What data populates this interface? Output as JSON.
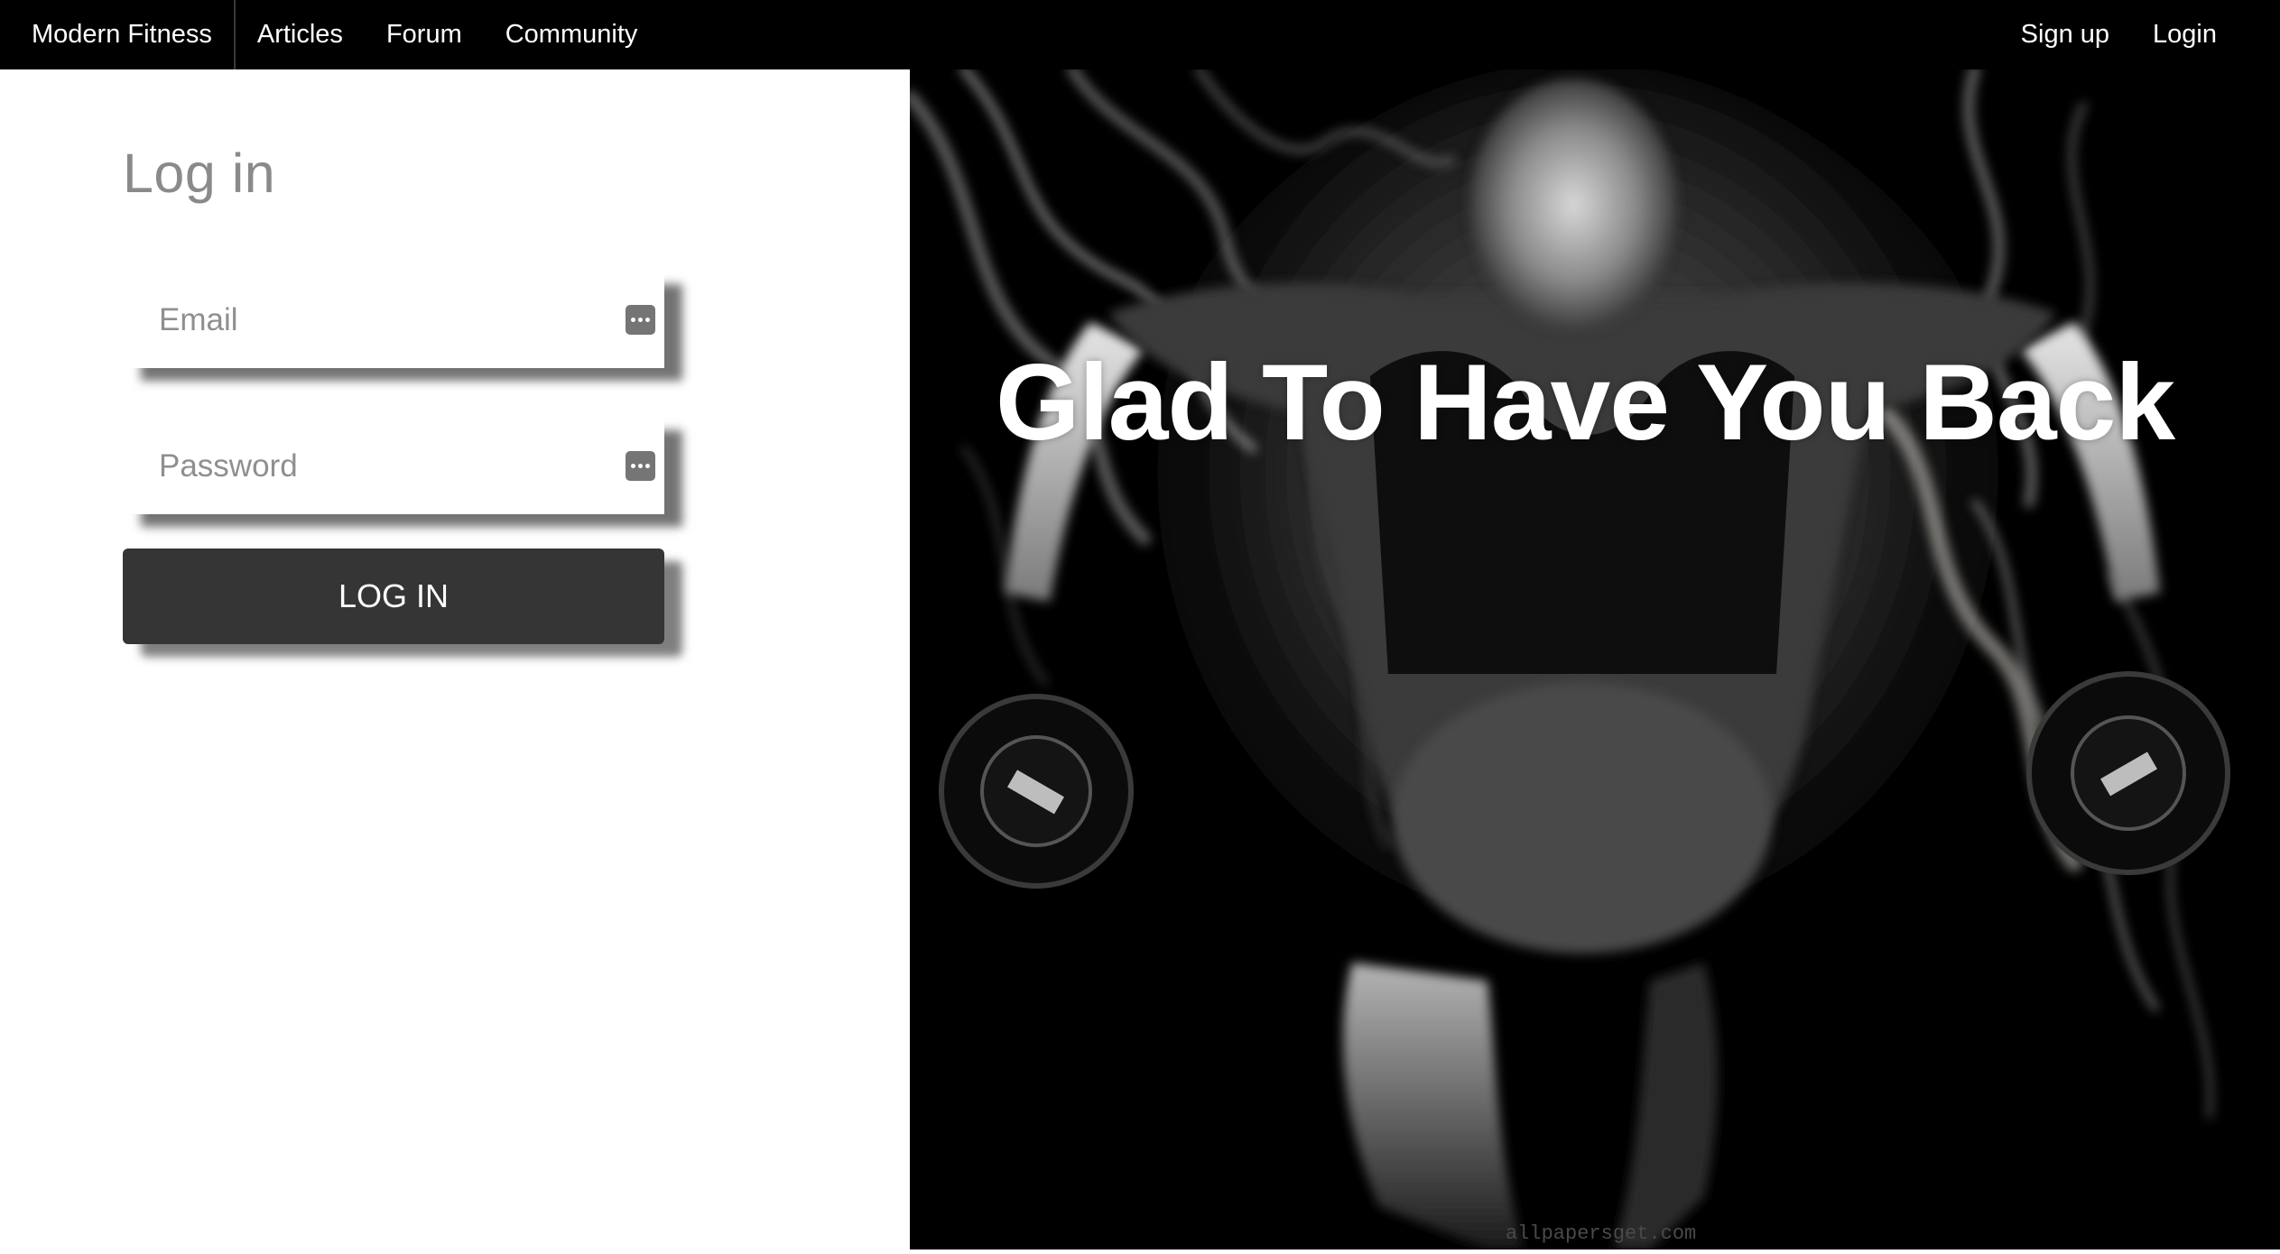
{
  "navbar": {
    "brand": "Modern Fitness",
    "links": [
      "Articles",
      "Forum",
      "Community"
    ],
    "right_links": [
      "Sign up",
      "Login"
    ]
  },
  "login": {
    "title": "Log in",
    "email_placeholder": "Email",
    "password_placeholder": "Password",
    "button_label": "LOG IN",
    "field_icon": "autofill-icon"
  },
  "hero": {
    "heading": "Glad To Have You Back",
    "watermark": "allpapersget.com",
    "image": "woman-lifting-dumbbells-smoke-photo"
  },
  "colors": {
    "navbar_bg": "#000000",
    "button_bg": "#353535",
    "title_text": "#8a8a8a",
    "hero_bg": "#000000"
  }
}
